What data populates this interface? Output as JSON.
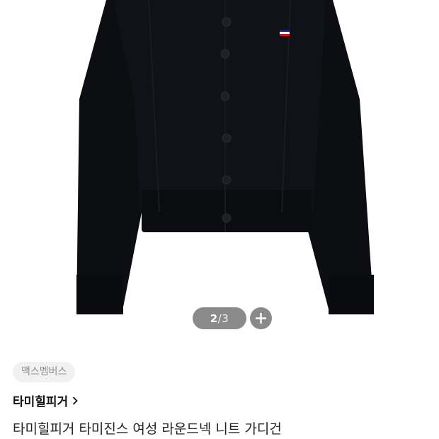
{
  "product_image": {
    "alt": "black round-neck knit cardigan",
    "icon": "cardigan-photo"
  },
  "pager": {
    "current": "2",
    "separator": "/",
    "total": "3",
    "zoom_icon": "plus-icon"
  },
  "seller": {
    "label": "맥스멤버스"
  },
  "brand": {
    "label": "타미힐피거",
    "chevron_icon": "chevron-right-icon"
  },
  "product": {
    "title": "타미힐피거 타미진스 여성 라운드넥 니트 가디건"
  },
  "colors": {
    "pill_bg": "#8a8a8a",
    "chip_bg": "#f1f1f1",
    "chip_text": "#8e8e8e",
    "garment": "#0e0f13"
  }
}
